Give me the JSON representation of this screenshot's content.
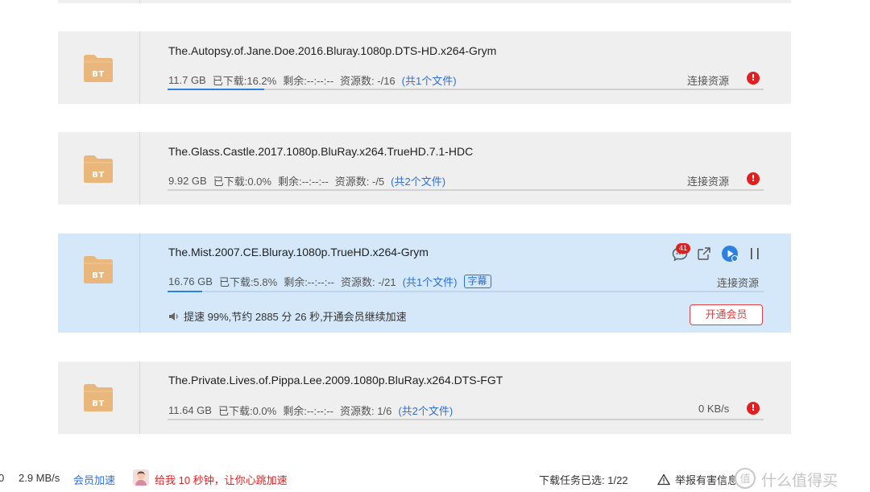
{
  "tasks": [
    {
      "name": "The.Autopsy.of.Jane.Doe.2016.Bluray.1080p.DTS-HD.x264-Grym",
      "size": "11.7 GB",
      "downloaded": "已下载:16.2%",
      "remaining": "剩余:--:--:--",
      "sources": "资源数: -/16",
      "files": "(共1个文件)",
      "status": "连接资源",
      "progress": 0.162
    },
    {
      "name": "The.Glass.Castle.2017.1080p.BluRay.x264.TrueHD.7.1-HDC",
      "size": "9.92 GB",
      "downloaded": "已下载:0.0%",
      "remaining": "剩余:--:--:--",
      "sources": "资源数: -/5",
      "files": "(共2个文件)",
      "status": "连接资源",
      "progress": 0.0
    },
    {
      "name": "The.Mist.2007.CE.Bluray.1080p.TrueHD.x264-Grym",
      "size": "16.76 GB",
      "downloaded": "已下载:5.8%",
      "remaining": "剩余:--:--:--",
      "sources": "资源数: -/21",
      "files": "(共1个文件)",
      "subtitle_tag": "字幕",
      "status": "连接资源",
      "progress": 0.058,
      "comment_count": "41",
      "speed_hint": "提速 99%,节约 2885 分 26 秒,开通会员继续加速",
      "vip_button": "开通会员"
    },
    {
      "name": "The.Private.Lives.of.Pippa.Lee.2009.1080p.BluRay.x264.DTS-FGT",
      "size": "11.64 GB",
      "downloaded": "已下载:0.0%",
      "remaining": "剩余:--:--:--",
      "sources": "资源数: 1/6",
      "files": "(共2个文件)",
      "status": "0 KB/s",
      "progress": 0.0
    }
  ],
  "folder_label": "BT",
  "error_glyph": "!",
  "statusbar": {
    "left_digit": "0",
    "speed": "2.9 MB/s",
    "vip_accel": "会员加速",
    "promo": "给我 10 秒钟，让你心跳加速",
    "selected": "下载任务已选: 1/22",
    "report": "举报有害信息",
    "watermark": "值 什么值得买"
  },
  "colors": {
    "accent": "#2d6fd6",
    "progress": "#2d82e0",
    "danger": "#e02020",
    "folder": "#e9b77c",
    "active_row": "#d4e8f9"
  }
}
